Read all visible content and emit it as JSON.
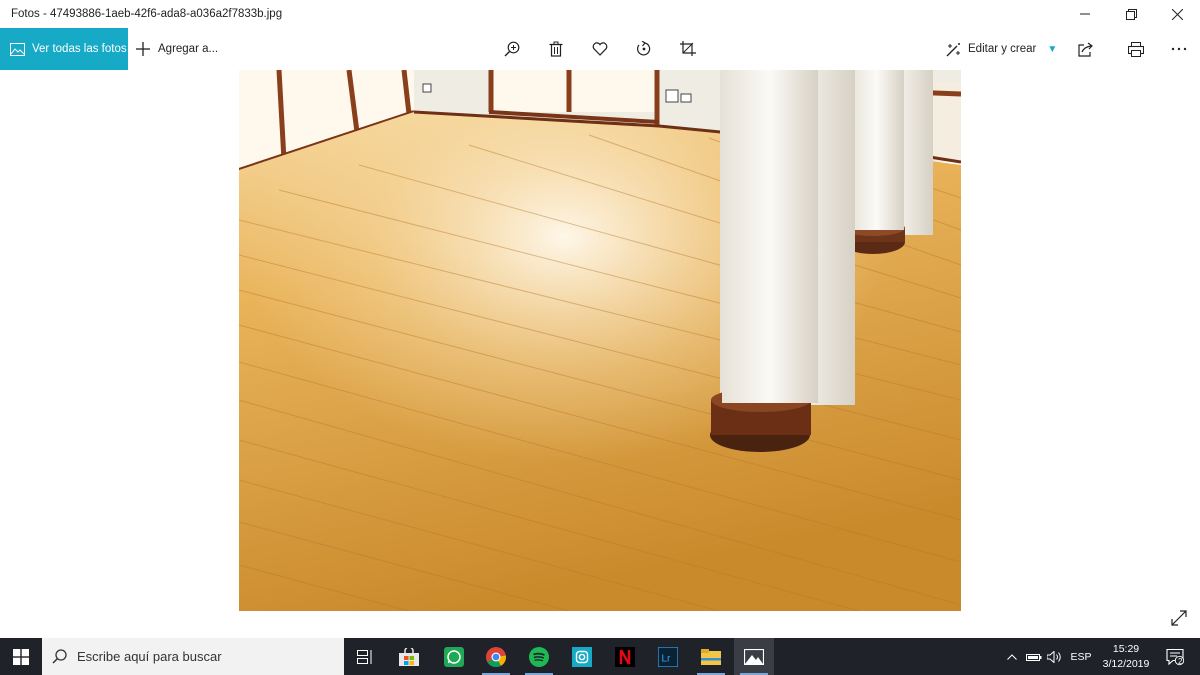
{
  "window": {
    "title": "Fotos - 47493886-1aeb-42f6-ada8-a036a2f7833b.jpg",
    "controls": [
      "minimize-icon",
      "restore-icon",
      "close-icon"
    ]
  },
  "toolbar": {
    "all_photos_label": "Ver todas las fotos",
    "add_to_label": "Agregar a...",
    "tools": [
      "zoom-in-icon",
      "delete-icon",
      "favorite-icon",
      "rotate-icon",
      "crop-icon"
    ],
    "edit_create_label": "Editar y crear",
    "right_tools": [
      "share-icon",
      "print-icon",
      "more-icon"
    ]
  },
  "photo": {
    "description_icon": "image",
    "alt": "47493886-1aeb-42f6-ada8-a036a2f7833b.jpg"
  },
  "taskbar": {
    "search_placeholder": "Escribe aquí para buscar",
    "apps": [
      "task-view-icon",
      "store-icon",
      "whatsapp-icon",
      "chrome-icon",
      "spotify-icon",
      "instagram-icon",
      "netflix-icon",
      "lightroom-icon",
      "file-explorer-icon",
      "photos-icon"
    ],
    "language": "ESP",
    "time": "15:29",
    "date": "3/12/2019",
    "notification_count": "2"
  },
  "colors": {
    "accent": "#16aac6",
    "taskbar_bg": "#1f2229"
  }
}
